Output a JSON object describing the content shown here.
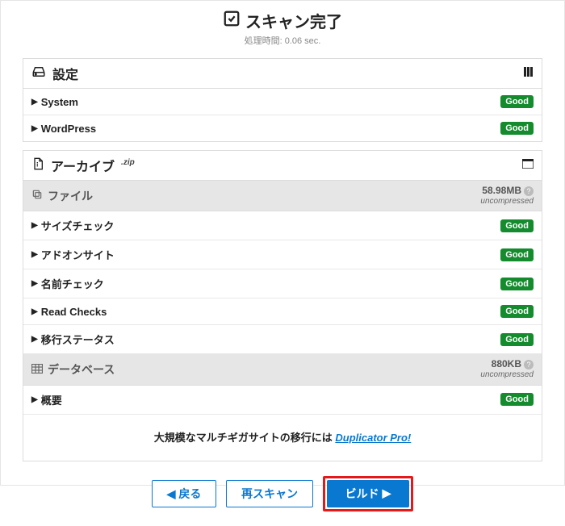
{
  "header": {
    "title": "スキャン完了",
    "subtitle": "処理時間: 0.06 sec."
  },
  "settings": {
    "title": "設定",
    "rows": [
      {
        "label": "System",
        "status": "Good"
      },
      {
        "label": "WordPress",
        "status": "Good"
      }
    ]
  },
  "archive": {
    "title": "アーカイブ",
    "ext": ".zip",
    "files_header": {
      "label": "ファイル",
      "size": "58.98MB",
      "note": "uncompressed"
    },
    "file_rows": [
      {
        "label": "サイズチェック",
        "status": "Good"
      },
      {
        "label": "アドオンサイト",
        "status": "Good"
      },
      {
        "label": "名前チェック",
        "status": "Good"
      },
      {
        "label": "Read Checks",
        "status": "Good"
      },
      {
        "label": "移行ステータス",
        "status": "Good"
      }
    ],
    "db_header": {
      "label": "データベース",
      "size": "880KB",
      "note": "uncompressed"
    },
    "db_rows": [
      {
        "label": "概要",
        "status": "Good"
      }
    ]
  },
  "promo": {
    "text_prefix": "大規模なマルチギガサイトの移行には ",
    "link_text": "Duplicator Pro!"
  },
  "buttons": {
    "back": "戻る",
    "rescan": "再スキャン",
    "build": "ビルド"
  }
}
